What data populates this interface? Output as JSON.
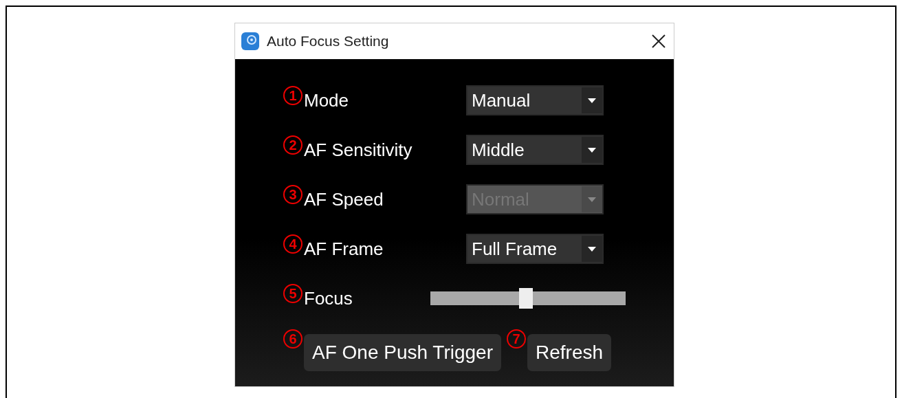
{
  "window": {
    "title": "Auto Focus Setting"
  },
  "settings": [
    {
      "marker": "1",
      "label": "Mode",
      "kind": "dropdown",
      "value": "Manual",
      "disabled": false
    },
    {
      "marker": "2",
      "label": "AF Sensitivity",
      "kind": "dropdown",
      "value": "Middle",
      "disabled": false
    },
    {
      "marker": "3",
      "label": "AF Speed",
      "kind": "dropdown",
      "value": "Normal",
      "disabled": true
    },
    {
      "marker": "4",
      "label": "AF Frame",
      "kind": "dropdown",
      "value": "Full Frame",
      "disabled": false
    },
    {
      "marker": "5",
      "label": "Focus",
      "kind": "slider",
      "level": 0.49
    }
  ],
  "buttons": [
    {
      "marker": "6",
      "label": "AF One Push Trigger"
    },
    {
      "marker": "7",
      "label": "Refresh"
    }
  ]
}
